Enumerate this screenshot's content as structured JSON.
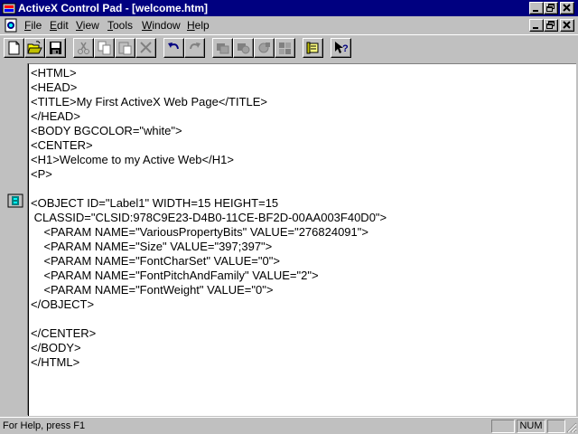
{
  "window": {
    "title": "ActiveX Control Pad - [welcome.htm]",
    "buttons": {
      "minimize": "_",
      "restore": "🗗",
      "close": "✕"
    },
    "mdi_buttons": {
      "minimize": "_",
      "restore": "🗗",
      "close": "✕"
    }
  },
  "menubar": {
    "items": [
      {
        "label": "File",
        "accel": "F",
        "rest": "ile"
      },
      {
        "label": "Edit",
        "accel": "E",
        "rest": "dit"
      },
      {
        "label": "View",
        "accel": "V",
        "rest": "iew"
      },
      {
        "label": "Tools",
        "accel": "T",
        "rest": "ools"
      },
      {
        "label": "Window",
        "accel": "W",
        "rest": "indow"
      },
      {
        "label": "Help",
        "accel": "H",
        "rest": "elp"
      }
    ]
  },
  "toolbar": {
    "buttons": [
      {
        "name": "new-icon",
        "enabled": true
      },
      {
        "name": "open-icon",
        "enabled": true
      },
      {
        "name": "save-icon",
        "enabled": true
      },
      {
        "name": "cut-icon",
        "enabled": false
      },
      {
        "name": "copy-icon",
        "enabled": false
      },
      {
        "name": "paste-icon",
        "enabled": false
      },
      {
        "name": "delete-icon",
        "enabled": false
      },
      {
        "name": "undo-icon",
        "enabled": true
      },
      {
        "name": "redo-icon",
        "enabled": false
      },
      {
        "name": "insert-control-icon",
        "enabled": false
      },
      {
        "name": "edit-control-icon",
        "enabled": false
      },
      {
        "name": "script-wizard-icon",
        "enabled": false
      },
      {
        "name": "layout-icon",
        "enabled": false
      },
      {
        "name": "scroll-icon",
        "enabled": true
      },
      {
        "name": "context-help-icon",
        "enabled": true
      }
    ]
  },
  "editor": {
    "lines": [
      "<HTML>",
      "<HEAD>",
      "<TITLE>My First ActiveX Web Page</TITLE>",
      "</HEAD>",
      "<BODY BGCOLOR=\"white\">",
      "<CENTER>",
      "<H1>Welcome to my Active Web</H1>",
      "<P>",
      "",
      "<OBJECT ID=\"Label1\" WIDTH=15 HEIGHT=15",
      " CLASSID=\"CLSID:978C9E23-D4B0-11CE-BF2D-00AA003F40D0\">",
      "    <PARAM NAME=\"VariousPropertyBits\" VALUE=\"276824091\">",
      "    <PARAM NAME=\"Size\" VALUE=\"397;397\">",
      "    <PARAM NAME=\"FontCharSet\" VALUE=\"0\">",
      "    <PARAM NAME=\"FontPitchAndFamily\" VALUE=\"2\">",
      "    <PARAM NAME=\"FontWeight\" VALUE=\"0\">",
      "</OBJECT>",
      "",
      "</CENTER>",
      "</BODY>",
      "</HTML>"
    ]
  },
  "statusbar": {
    "help_text": "For Help, press F1",
    "panel_blank": "",
    "num_indicator": "NUM",
    "panel_blank2": ""
  },
  "colors": {
    "titlebar": "#000080",
    "face": "#c0c0c0",
    "editor_bg": "#ffffff"
  }
}
